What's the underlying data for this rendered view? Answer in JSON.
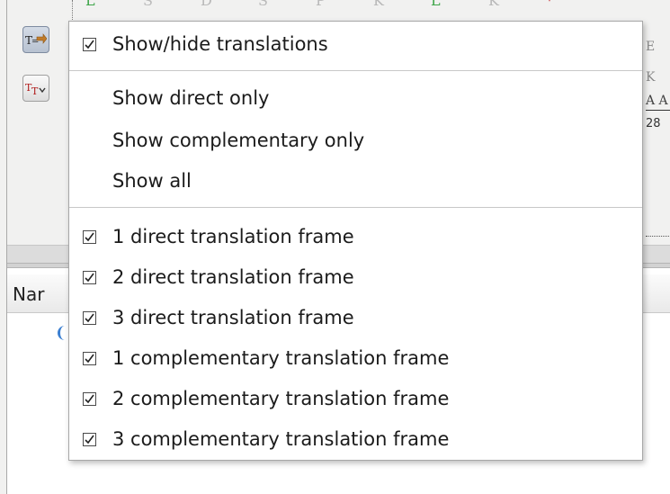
{
  "sequence": {
    "letters": [
      {
        "char": "L",
        "color": "green"
      },
      {
        "char": "S",
        "color": "grey"
      },
      {
        "char": "D",
        "color": "grey"
      },
      {
        "char": "S",
        "color": "grey"
      },
      {
        "char": "P",
        "color": "grey"
      },
      {
        "char": "K",
        "color": "grey"
      },
      {
        "char": "L",
        "color": "green"
      },
      {
        "char": "K",
        "color": "grey"
      },
      {
        "char": "*",
        "color": "red"
      }
    ],
    "right_edge": {
      "e": "E",
      "k": "K",
      "aa": "A A",
      "num": "28"
    }
  },
  "toolbar": {
    "show_translations_icon": "translation-toggle-icon",
    "translation_settings_icon": "translation-settings-icon"
  },
  "table": {
    "header_label": "Nar"
  },
  "menu": {
    "toggle": {
      "label": "Show/hide translations",
      "checked": true
    },
    "modes": [
      {
        "label": "Show direct only"
      },
      {
        "label": "Show complementary only"
      },
      {
        "label": "Show all"
      }
    ],
    "frames": [
      {
        "label": "1 direct translation frame",
        "checked": true
      },
      {
        "label": "2 direct translation frame",
        "checked": true
      },
      {
        "label": "3 direct translation frame",
        "checked": true
      },
      {
        "label": "1 complementary translation frame",
        "checked": true
      },
      {
        "label": "2 complementary translation frame",
        "checked": true
      },
      {
        "label": "3 complementary translation frame",
        "checked": true
      }
    ]
  },
  "colors": {
    "accent_green": "#3fa64a",
    "accent_red": "#c3141b",
    "menu_bg": "#ffffff",
    "panel_bg": "#f1f1f0"
  }
}
